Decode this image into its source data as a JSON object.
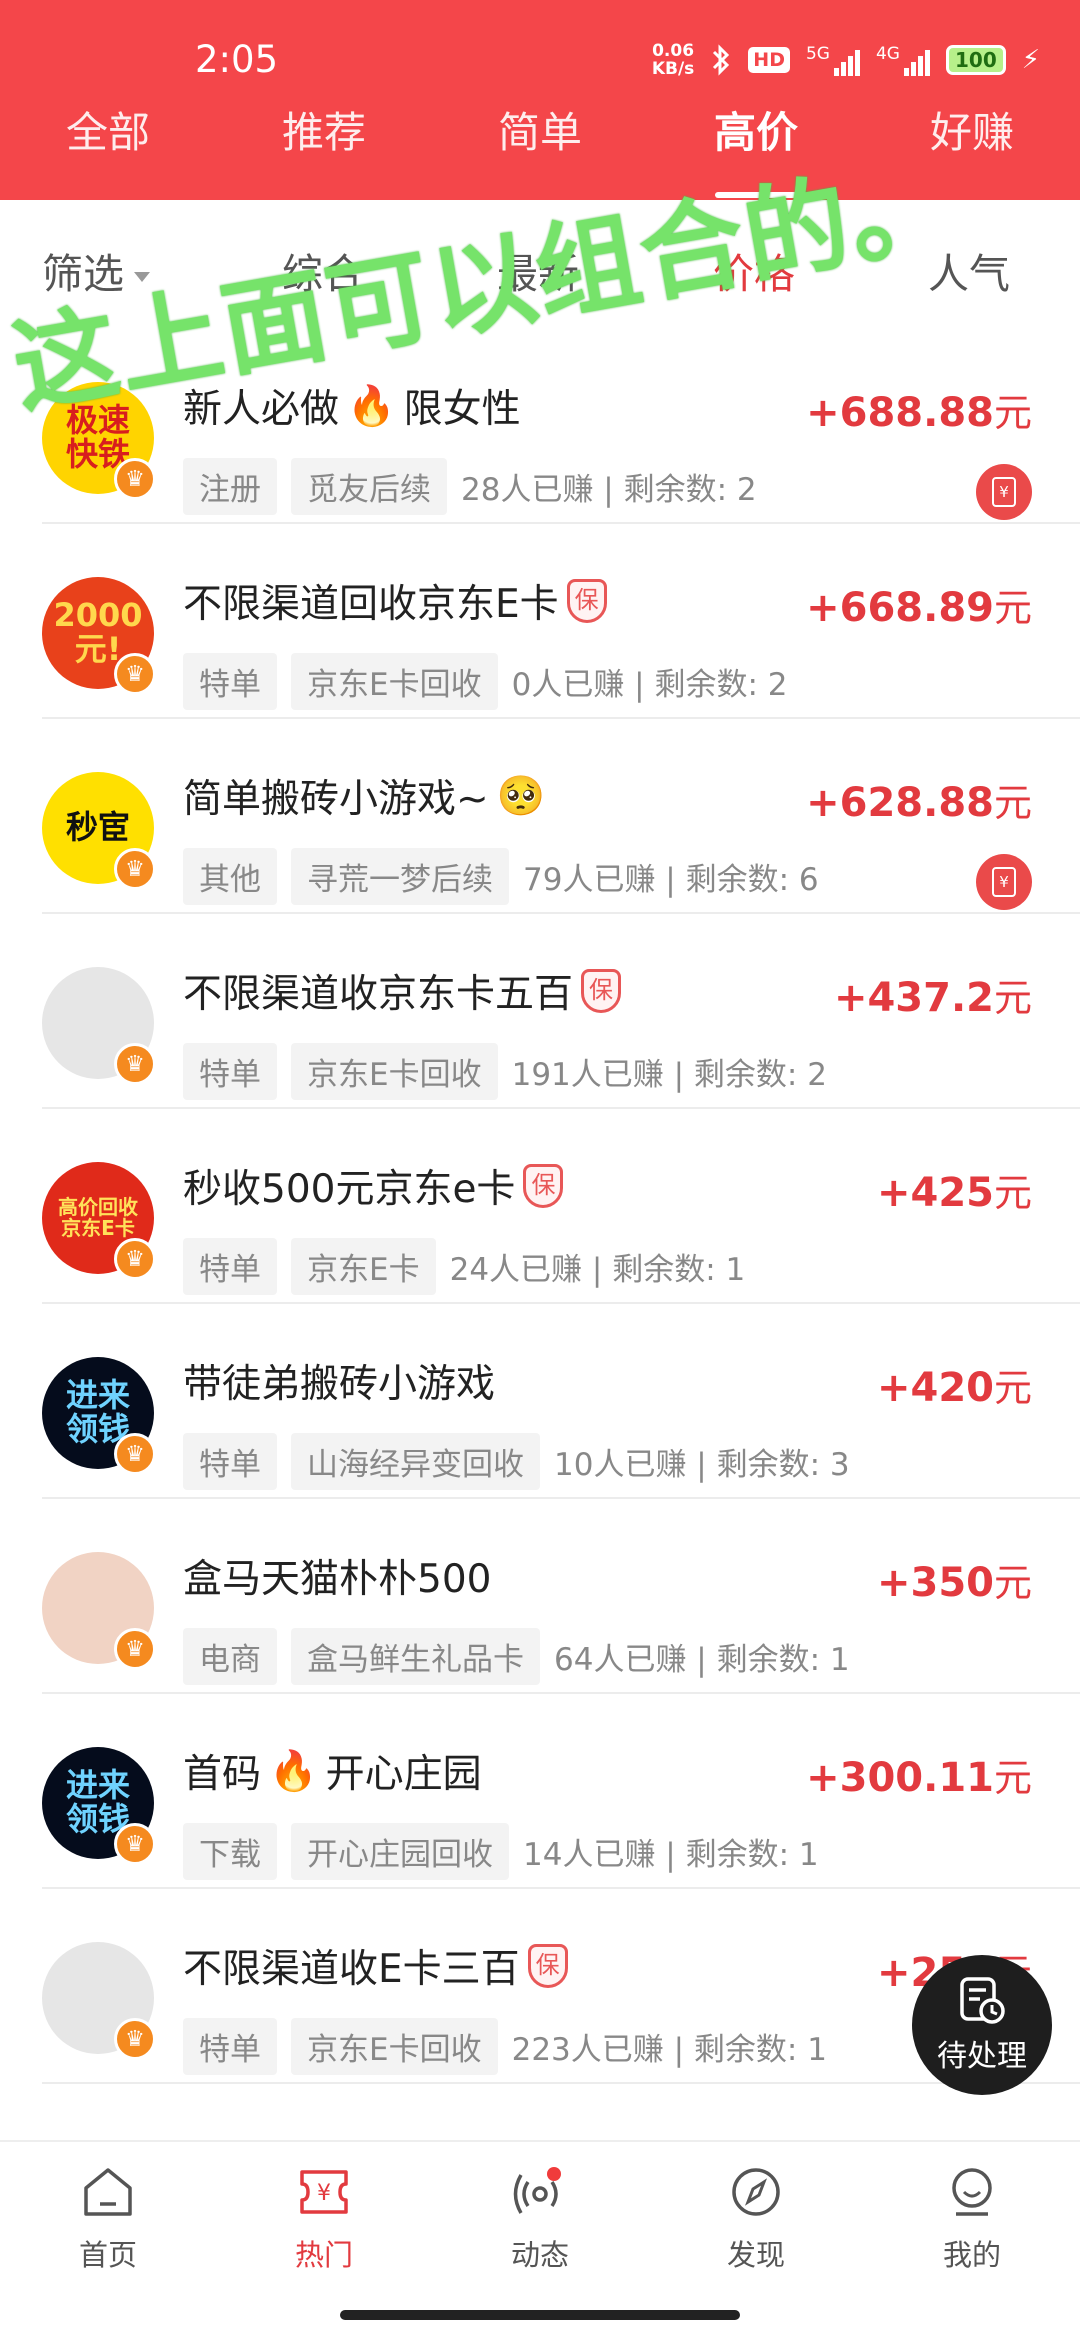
{
  "status_bar": {
    "time": "2:05",
    "speed_value": "0.06",
    "speed_unit": "KB/s",
    "hd_label": "HD",
    "net1": "5G",
    "net2": "4G",
    "battery": "100"
  },
  "tabs": [
    {
      "label": "全部"
    },
    {
      "label": "推荐"
    },
    {
      "label": "简单"
    },
    {
      "label": "高价",
      "active": true
    },
    {
      "label": "好赚"
    }
  ],
  "sort": {
    "filter": "筛选",
    "options": [
      "综合",
      "最新",
      "价格",
      "人气"
    ],
    "active": "价格"
  },
  "overlay_note": "这上面可以组合的。",
  "items": [
    {
      "title": "新人必做",
      "title_suffix": "限女性",
      "emoji": "🔥",
      "badge": "",
      "price": "+688.88",
      "unit": "元",
      "category": "注册",
      "source": "觅友后续",
      "stats": "28人已赚 | 剩余数: 2",
      "avatar_text": "极速\n快铁",
      "avatar_bg": "#ffd400",
      "avatar_color": "#d81e1e",
      "redpack": true
    },
    {
      "title": "不限渠道回收京东E卡",
      "title_suffix": "",
      "emoji": "",
      "badge": "保",
      "price": "+668.89",
      "unit": "元",
      "category": "特单",
      "source": "京东E卡回收",
      "stats": "0人已赚 | 剩余数: 2",
      "avatar_text": "2000元!",
      "avatar_bg": "#e8411b",
      "avatar_color": "#ffd84d",
      "redpack": false
    },
    {
      "title": "简单搬砖小游戏~",
      "title_suffix": "",
      "emoji": "🥺",
      "badge": "",
      "price": "+628.88",
      "unit": "元",
      "category": "其他",
      "source": "寻荒一梦后续",
      "stats": "79人已赚 | 剩余数: 6",
      "avatar_text": "秒宦",
      "avatar_bg": "#ffe000",
      "avatar_color": "#111111",
      "redpack": true
    },
    {
      "title": "不限渠道收京东卡五百",
      "title_suffix": "",
      "emoji": "",
      "badge": "保",
      "price": "+437.2",
      "unit": "元",
      "category": "特单",
      "source": "京东E卡回收",
      "stats": "191人已赚 | 剩余数: 2",
      "avatar_text": "",
      "avatar_bg": "#e6e6e6",
      "avatar_color": "#333333",
      "redpack": false
    },
    {
      "title": "秒收500元京东e卡",
      "title_suffix": "",
      "emoji": "",
      "badge": "保",
      "price": "+425",
      "unit": "元",
      "category": "特单",
      "source": "京东E卡",
      "stats": "24人已赚 | 剩余数: 1",
      "avatar_text": "高价回收\n京东E卡",
      "avatar_bg": "#e02a1a",
      "avatar_color": "#ffe25a",
      "redpack": false
    },
    {
      "title": "带徒弟搬砖小游戏",
      "title_suffix": "",
      "emoji": "",
      "badge": "",
      "price": "+420",
      "unit": "元",
      "category": "特单",
      "source": "山海经异变回收",
      "stats": "10人已赚 | 剩余数: 3",
      "avatar_text": "进来\n领钱",
      "avatar_bg": "#050c1c",
      "avatar_color": "#6fd3ff",
      "redpack": false
    },
    {
      "title": "盒马天猫朴朴500",
      "title_suffix": "",
      "emoji": "",
      "badge": "",
      "price": "+350",
      "unit": "元",
      "category": "电商",
      "source": "盒马鲜生礼品卡",
      "stats": "64人已赚 | 剩余数: 1",
      "avatar_text": "",
      "avatar_bg": "#f1d3c4",
      "avatar_color": "#333333",
      "redpack": false
    },
    {
      "title": "首码",
      "title_suffix": "开心庄园",
      "emoji": "🔥",
      "badge": "",
      "price": "+300.11",
      "unit": "元",
      "category": "下载",
      "source": "开心庄园回收",
      "stats": "14人已赚 | 剩余数: 1",
      "avatar_text": "进来\n领钱",
      "avatar_bg": "#050c1c",
      "avatar_color": "#6fd3ff",
      "redpack": false
    },
    {
      "title": "不限渠道收E卡三百",
      "title_suffix": "",
      "emoji": "",
      "badge": "保",
      "price": "+254",
      "unit": "元",
      "category": "特单",
      "source": "京东E卡回收",
      "stats": "223人已赚 | 剩余数: 1",
      "avatar_text": "",
      "avatar_bg": "#e6e6e6",
      "avatar_color": "#333333",
      "redpack": false
    }
  ],
  "fab": {
    "label": "待处理"
  },
  "bottom_nav": [
    {
      "label": "首页",
      "icon": "home-icon"
    },
    {
      "label": "热门",
      "icon": "hot-ticket-icon",
      "active": true
    },
    {
      "label": "动态",
      "icon": "broadcast-icon",
      "dot": true
    },
    {
      "label": "发现",
      "icon": "compass-icon"
    },
    {
      "label": "我的",
      "icon": "profile-icon"
    }
  ],
  "colors": {
    "brand_red": "#f4464a",
    "price_red": "#e23a3f",
    "overlay_green": "#76e36a"
  }
}
